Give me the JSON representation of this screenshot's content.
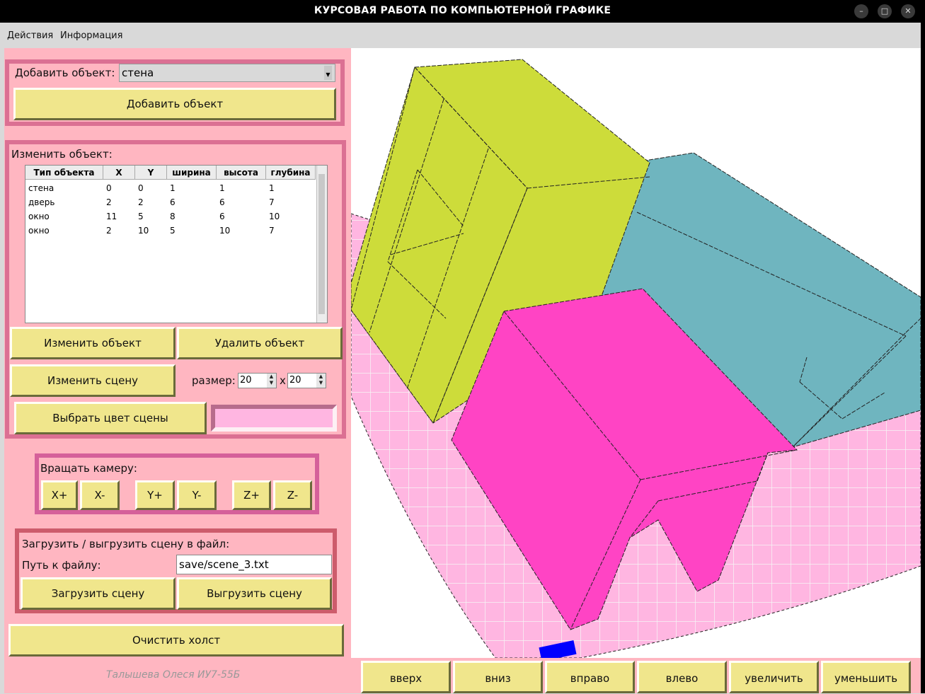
{
  "window": {
    "title": "КУРСОВАЯ РАБОТА ПО КОМПЬЮТЕРНОЙ ГРАФИКЕ",
    "minimize_icon": "minimize-icon",
    "maximize_icon": "maximize-icon",
    "close_icon": "close-icon"
  },
  "menu": {
    "items": [
      "Действия",
      "Информация"
    ]
  },
  "add_object": {
    "label": "Добавить объект:",
    "selected": "стена",
    "button": "Добавить объект"
  },
  "edit_object": {
    "label": "Изменить объект:",
    "columns": [
      "Тип объекта",
      "X",
      "Y",
      "ширина",
      "высота",
      "глубина"
    ],
    "rows": [
      [
        "стена",
        "0",
        "0",
        "1",
        "1",
        "1"
      ],
      [
        "дверь",
        "2",
        "2",
        "6",
        "6",
        "7"
      ],
      [
        "окно",
        "11",
        "5",
        "8",
        "6",
        "10"
      ],
      [
        "окно",
        "2",
        "10",
        "5",
        "10",
        "7"
      ]
    ],
    "change_button": "Изменить объект",
    "delete_button": "Удалить объект",
    "change_scene_button": "Изменить сцену",
    "size_label": "размер:",
    "size_w": "20",
    "size_x": "x",
    "size_h": "20",
    "color_button": "Выбрать цвет сцены",
    "scene_color": "#ffb6e1"
  },
  "camera": {
    "label": "Вращать камеру:",
    "buttons": [
      "X+",
      "X-",
      "Y+",
      "Y-",
      "Z+",
      "Z-"
    ]
  },
  "file": {
    "label": "Загрузить / выгрузить сцену в файл:",
    "path_label": "Путь к файлу:",
    "path": "save/scene_3.txt",
    "load_button": "Загрузить сцену",
    "save_button": "Выгрузить сцену"
  },
  "clear_button": "Очистить холст",
  "author": "Талышева Олеся ИУ7-55Б",
  "nav_buttons": [
    "вверх",
    "вниз",
    "вправо",
    "влево",
    "увеличить",
    "уменьшить"
  ],
  "colors": {
    "panel": "#ffb6c1",
    "frame": "#db7093",
    "button": "#f0e68c",
    "floor": "#ffb6e1",
    "yellow_box": "#cddc3a",
    "teal_box": "#6fb5bf",
    "magenta_box": "#ff44c4",
    "marker": "#0000ff"
  }
}
